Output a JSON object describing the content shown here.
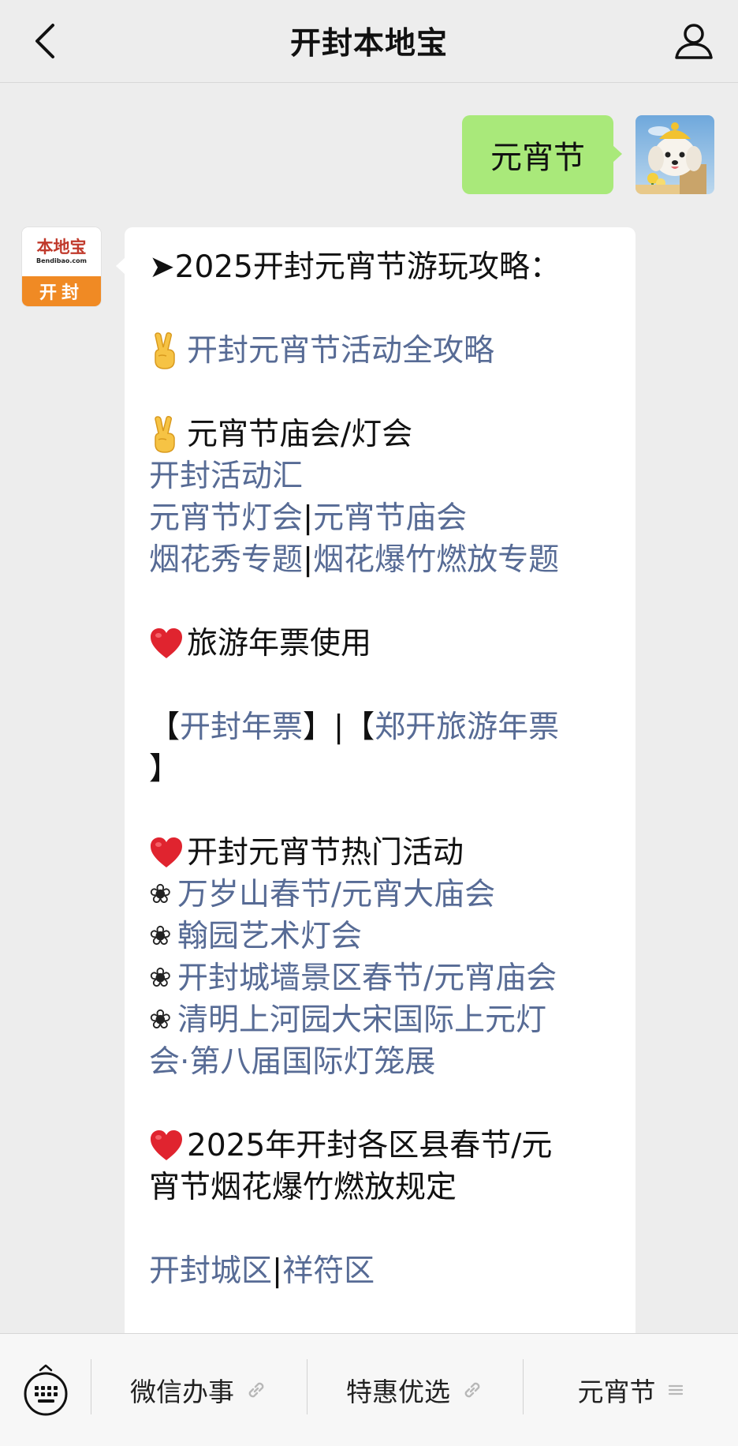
{
  "header": {
    "title": "开封本地宝",
    "back_icon": "chevron-left-icon",
    "profile_icon": "user-icon"
  },
  "sent": {
    "text": "元宵节"
  },
  "received": {
    "avatar": {
      "brand": "本地宝",
      "domain": "Bendibao.com",
      "city": "开封"
    },
    "lines": [
      {
        "type": "text",
        "parts": [
          {
            "t": "➤2025开封元宵节游玩攻略：",
            "link": false
          }
        ]
      },
      {
        "type": "gap"
      },
      {
        "type": "text",
        "icon": "victory-hand-icon",
        "parts": [
          {
            "t": "开封元宵节活动全攻略",
            "link": true
          }
        ]
      },
      {
        "type": "gap"
      },
      {
        "type": "text",
        "icon": "victory-hand-icon",
        "parts": [
          {
            "t": "元宵节庙会/灯会",
            "link": false
          }
        ]
      },
      {
        "type": "text",
        "parts": [
          {
            "t": "开封活动汇",
            "link": true
          }
        ]
      },
      {
        "type": "text",
        "parts": [
          {
            "t": "元宵节灯会",
            "link": true
          },
          {
            "t": "|",
            "link": false
          },
          {
            "t": "元宵节庙会",
            "link": true
          }
        ]
      },
      {
        "type": "text",
        "parts": [
          {
            "t": "烟花秀专题",
            "link": true
          },
          {
            "t": "|",
            "link": false
          },
          {
            "t": "烟花爆竹燃放专题",
            "link": true
          }
        ]
      },
      {
        "type": "gap"
      },
      {
        "type": "text",
        "icon": "red-heart-icon",
        "parts": [
          {
            "t": "旅游年票使用",
            "link": false
          }
        ]
      },
      {
        "type": "gap"
      },
      {
        "type": "text",
        "parts": [
          {
            "t": "【",
            "link": false
          },
          {
            "t": "开封年票",
            "link": true
          },
          {
            "t": "】|【",
            "link": false
          },
          {
            "t": "郑开旅游年票",
            "link": true
          }
        ]
      },
      {
        "type": "text",
        "parts": [
          {
            "t": "】",
            "link": false
          }
        ]
      },
      {
        "type": "gap"
      },
      {
        "type": "text",
        "icon": "red-heart-icon",
        "parts": [
          {
            "t": "开封元宵节热门活动",
            "link": false
          }
        ]
      },
      {
        "type": "text",
        "flower": "❀",
        "parts": [
          {
            "t": "万岁山春节/元宵大庙会",
            "link": true
          }
        ]
      },
      {
        "type": "text",
        "flower": "❀",
        "parts": [
          {
            "t": "翰园艺术灯会",
            "link": true
          }
        ]
      },
      {
        "type": "text",
        "flower": "❀",
        "parts": [
          {
            "t": "开封城墙景区春节/元宵庙会",
            "link": true
          }
        ]
      },
      {
        "type": "text",
        "flower": "❀",
        "parts": [
          {
            "t": "清明上河园大宋国际上元灯",
            "link": true
          }
        ]
      },
      {
        "type": "text",
        "parts": [
          {
            "t": "会·第八届国际灯笼展",
            "link": true
          }
        ]
      },
      {
        "type": "gap"
      },
      {
        "type": "text",
        "icon": "red-heart-icon",
        "parts": [
          {
            "t": "2025年开封各区县春节/元",
            "link": false
          }
        ]
      },
      {
        "type": "text",
        "parts": [
          {
            "t": "宵节烟花爆竹燃放规定",
            "link": false
          }
        ]
      },
      {
        "type": "gap"
      },
      {
        "type": "text",
        "parts": [
          {
            "t": "开封城区",
            "link": true
          },
          {
            "t": "|",
            "link": false
          },
          {
            "t": "祥符区",
            "link": true
          }
        ]
      }
    ]
  },
  "menu": {
    "keyboard_icon": "keyboard-icon",
    "items": [
      {
        "label": "微信办事",
        "icon": "link-icon"
      },
      {
        "label": "特惠优选",
        "icon": "link-icon"
      },
      {
        "label": "元宵节",
        "icon": "menu-lines-icon"
      }
    ]
  },
  "colors": {
    "background": "#ededed",
    "sent_bubble": "#a9e97a",
    "link": "#576b95",
    "logo_orange": "#f08a24",
    "logo_red": "#c0392b"
  }
}
